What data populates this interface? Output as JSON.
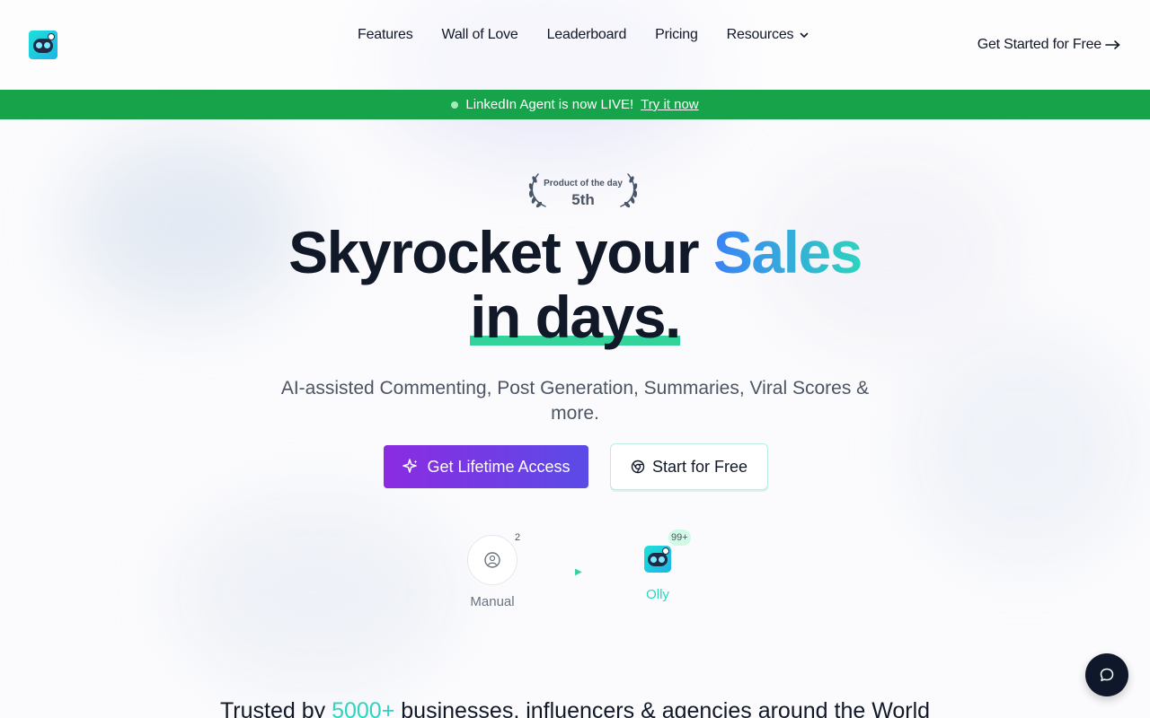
{
  "header": {
    "nav": [
      {
        "label": "Features"
      },
      {
        "label": "Wall of Love"
      },
      {
        "label": "Leaderboard"
      },
      {
        "label": "Pricing"
      },
      {
        "label": "Resources"
      }
    ],
    "cta_label": "Get Started for Free"
  },
  "banner": {
    "text": "LinkedIn Agent is now LIVE!",
    "link_label": "Try it now"
  },
  "award": {
    "title": "Product of the day",
    "rank": "5th"
  },
  "hero": {
    "headline_part1": "Skyrocket your ",
    "headline_highlight": "Sales",
    "headline_line2": "in days.",
    "subtitle": "AI-assisted Commenting, Post Generation, Summaries, Viral Scores & more.",
    "primary_button": "Get Lifetime Access",
    "secondary_button": "Start for Free"
  },
  "comparison": {
    "manual_label": "Manual",
    "manual_count": "2",
    "olly_label": "Olly",
    "olly_count": "99+"
  },
  "trusted": {
    "prefix": "Trusted by ",
    "count": "5000+",
    "suffix": " businesses, influencers & agencies around the World"
  },
  "colors": {
    "banner_green": "#16a34a",
    "primary_gradient_start": "#8b2be2",
    "primary_gradient_end": "#5b4be6",
    "accent_teal": "#2dd4bf",
    "accent_blue": "#3b82f6",
    "highlight_green": "#34d399"
  },
  "icons": {
    "logo": "robot-logo-icon",
    "resources_chevron": "chevron-down-icon",
    "cta_arrow": "arrow-right-icon",
    "primary_button_icon": "sparkles-icon",
    "secondary_button_icon": "chrome-icon",
    "manual_icon": "sad-face-icon",
    "chat": "chat-bubble-icon"
  }
}
